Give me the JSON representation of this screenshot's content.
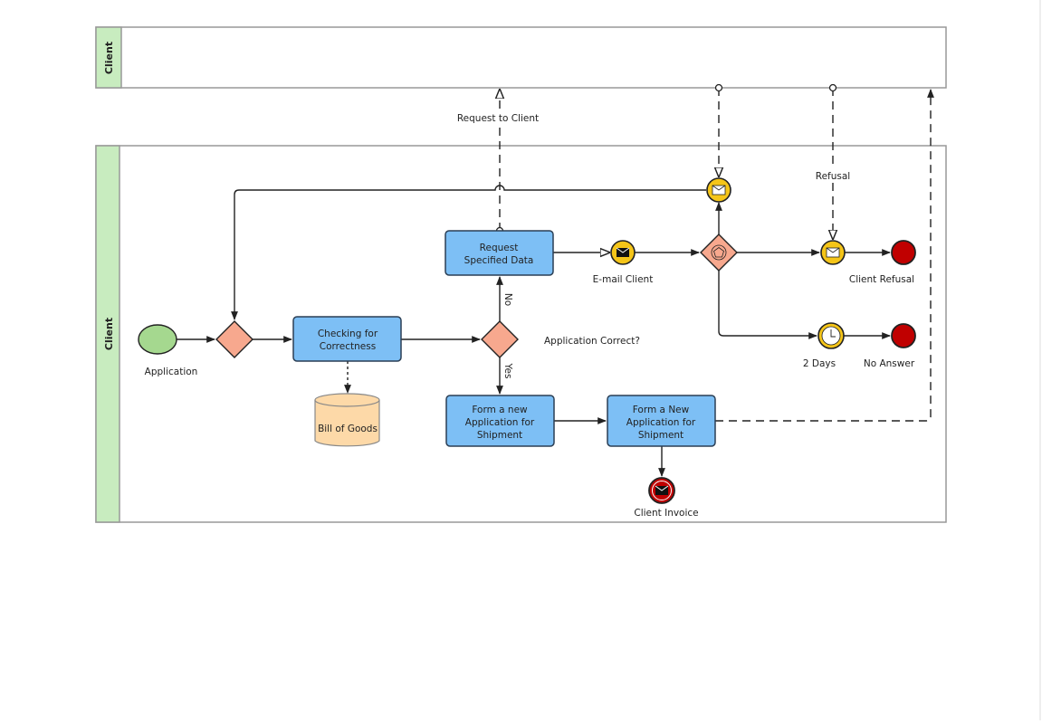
{
  "pools": [
    {
      "label": "Client"
    },
    {
      "label": "Client"
    }
  ],
  "nodes": {
    "start": {
      "label": "Application"
    },
    "check": {
      "line1": "Checking for",
      "line2": "Correctness"
    },
    "store": {
      "label": "Bill of Goods"
    },
    "gateway_question": {
      "label": "Application Correct?"
    },
    "request": {
      "line1": "Request",
      "line2": "Specified Data"
    },
    "form1": {
      "line1": "Form a new",
      "line2": "Application for",
      "line3": "Shipment"
    },
    "form2": {
      "line1": "Form a New",
      "line2": "Application for",
      "line3": "Shipment"
    },
    "email": {
      "label": "E-mail Client"
    },
    "refusal_end": {
      "label": "Client Refusal"
    },
    "timer": {
      "label": "2 Days"
    },
    "noanswer_end": {
      "label": "No Answer"
    },
    "invoice_end": {
      "label": "Client Invoice"
    }
  },
  "flows": {
    "no": "No",
    "yes": "Yes",
    "request_to_client": "Request to Client",
    "refusal": "Refusal"
  },
  "colors": {
    "task": "#7dbff5",
    "gateway": "#f7a88e",
    "event": "#f5c518",
    "end": "#c00000",
    "start": "#a5d88f",
    "lane": "#c8ecbf",
    "store": "#fdd9a8"
  }
}
